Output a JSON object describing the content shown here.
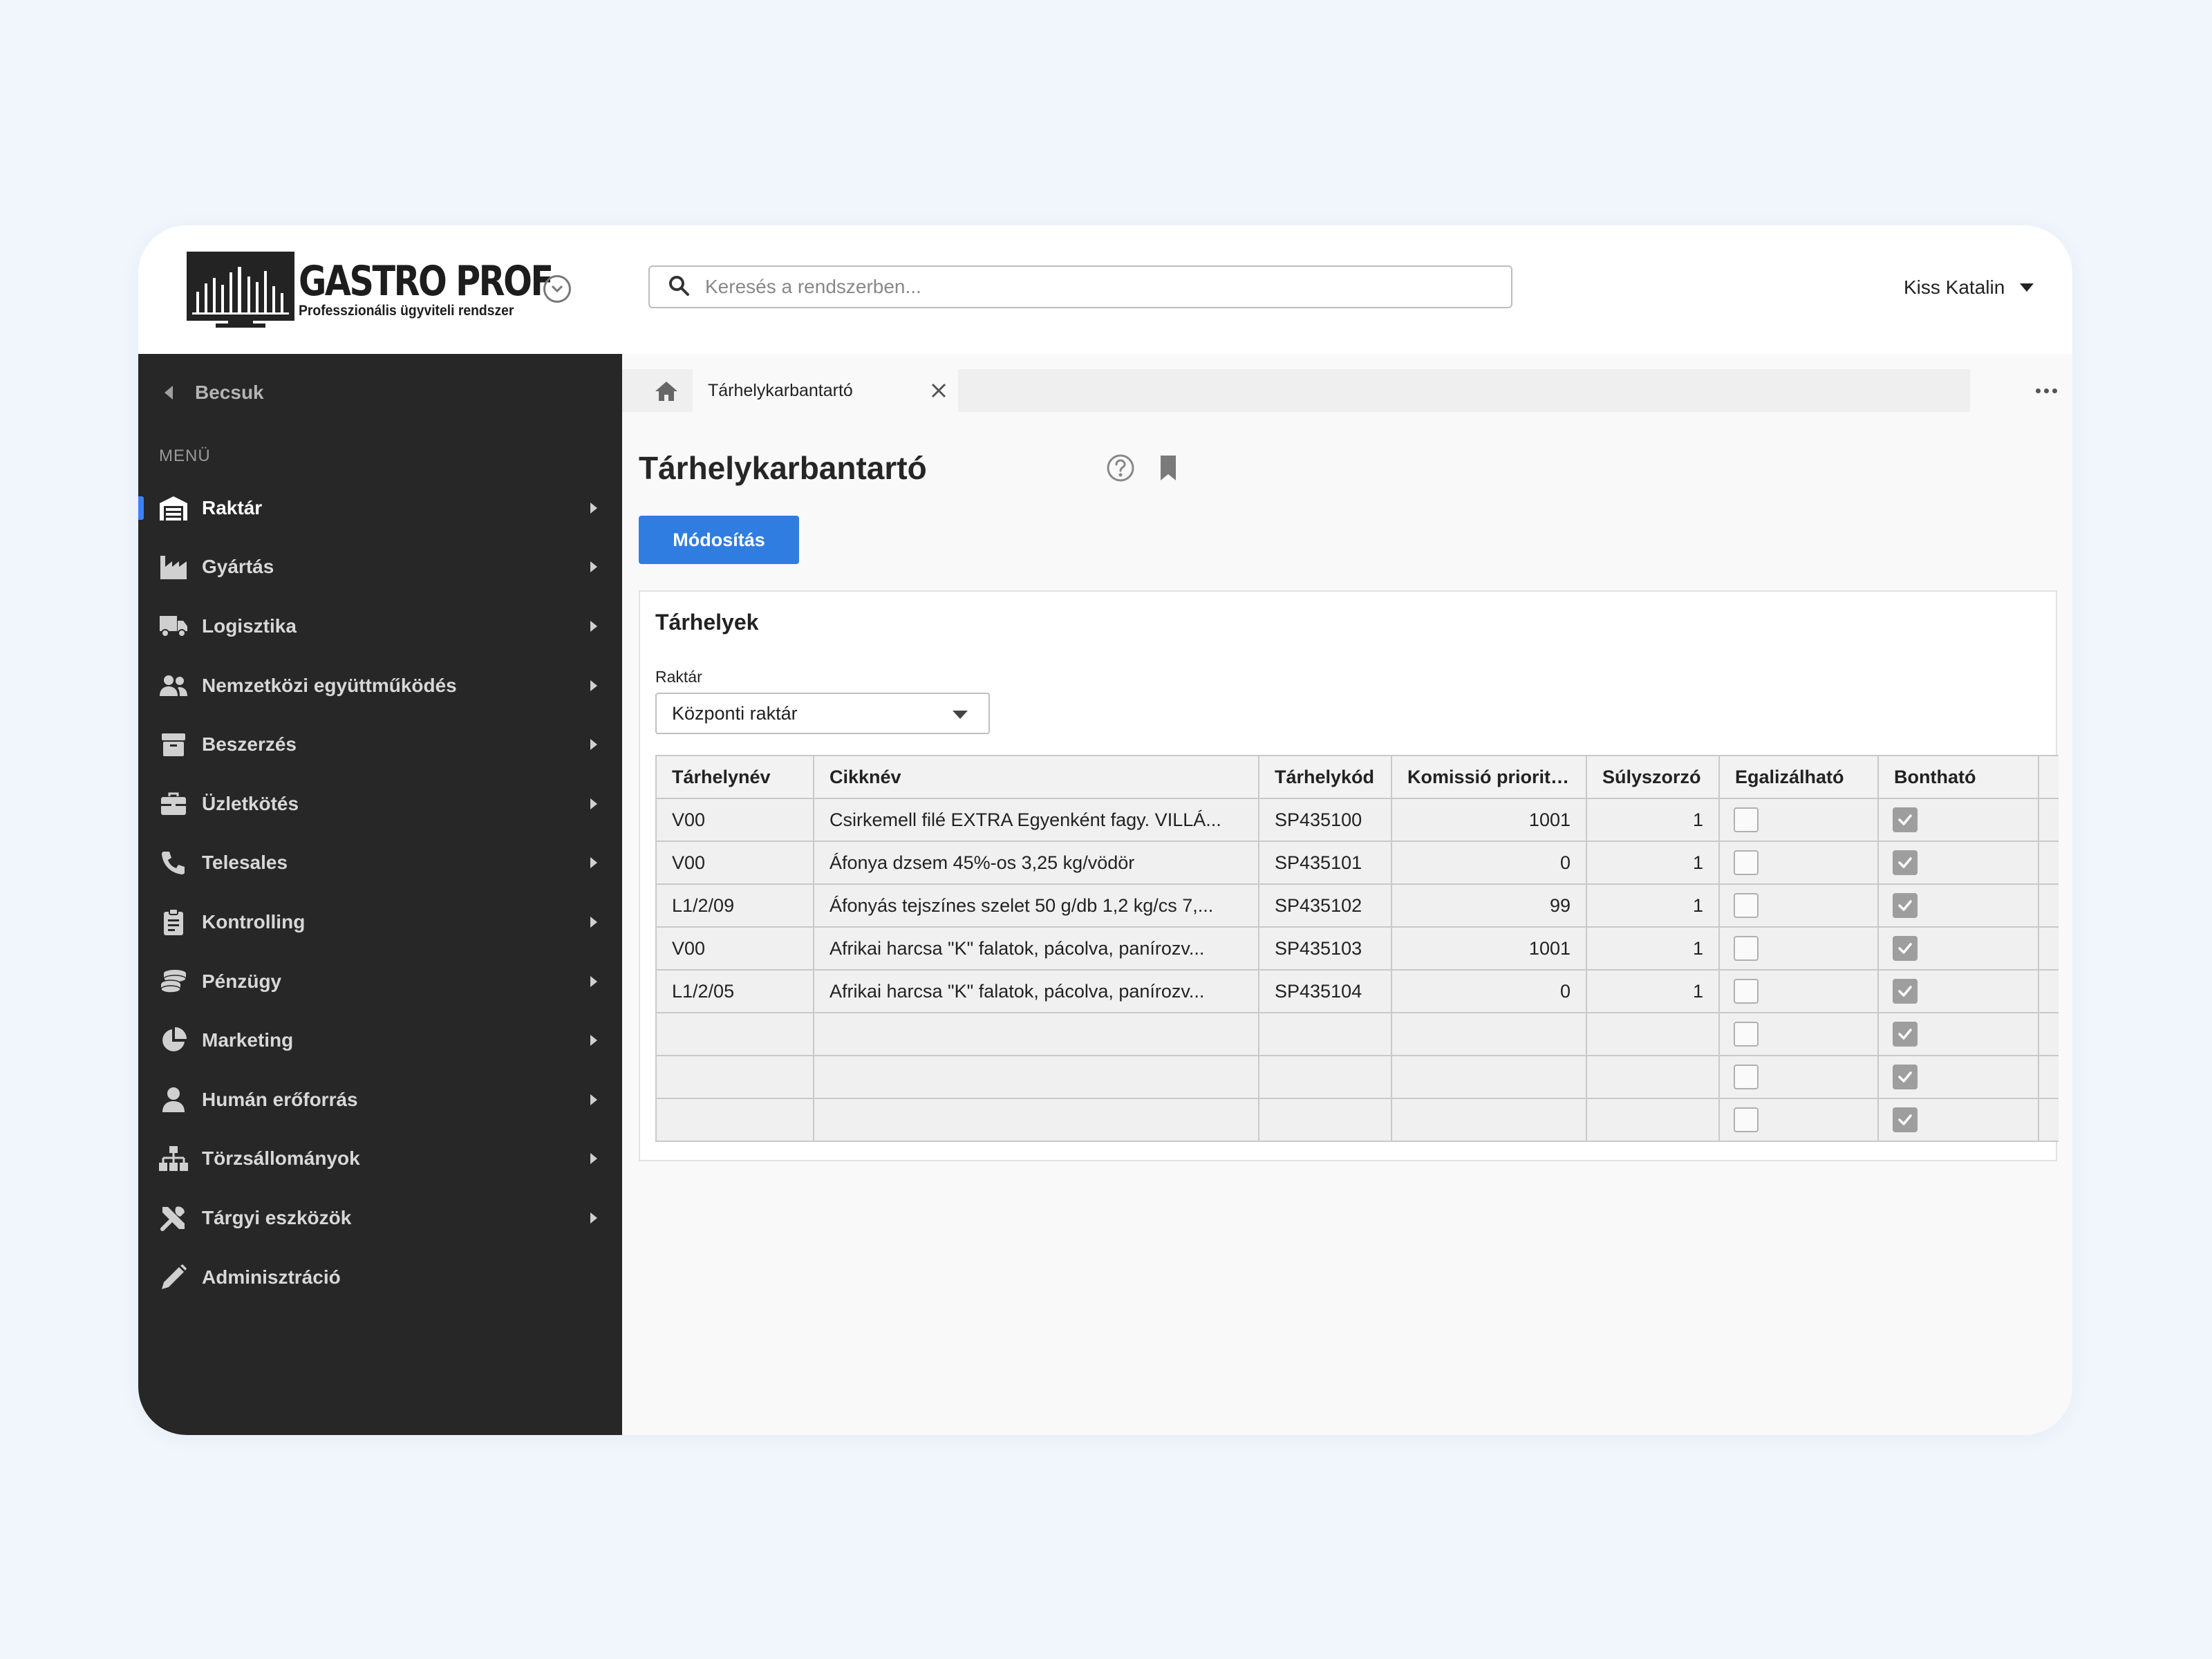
{
  "app": {
    "logo_title": "GASTRO PROF",
    "logo_subtitle": "Professzionális ügyviteli rendszer",
    "search_placeholder": "Keresés a rendszerben...",
    "user_name": "Kiss Katalin"
  },
  "sidebar": {
    "collapse_label": "Becsuk",
    "menu_label": "MENÜ",
    "items": [
      {
        "label": "Raktár",
        "icon": "warehouse-icon",
        "active": true
      },
      {
        "label": "Gyártás",
        "icon": "factory-icon"
      },
      {
        "label": "Logisztika",
        "icon": "truck-icon"
      },
      {
        "label": "Nemzetközi együttműködés",
        "icon": "users-icon"
      },
      {
        "label": "Beszerzés",
        "icon": "box-icon"
      },
      {
        "label": "Üzletkötés",
        "icon": "briefcase-icon"
      },
      {
        "label": "Telesales",
        "icon": "phone-icon"
      },
      {
        "label": "Kontrolling",
        "icon": "clipboard-icon"
      },
      {
        "label": "Pénzügy",
        "icon": "coins-icon"
      },
      {
        "label": "Marketing",
        "icon": "pie-chart-icon"
      },
      {
        "label": "Humán erőforrás",
        "icon": "user-icon"
      },
      {
        "label": "Törzsállományok",
        "icon": "sitemap-icon"
      },
      {
        "label": "Tárgyi eszközök",
        "icon": "tools-icon"
      },
      {
        "label": "Adminisztráció",
        "icon": "pencil-icon"
      }
    ]
  },
  "tabs": {
    "active_tab": "Tárhelykarbantartó"
  },
  "page": {
    "title": "Tárhelykarbantartó",
    "modify_button": "Módosítás"
  },
  "panel": {
    "title": "Tárhelyek",
    "warehouse_label": "Raktár",
    "warehouse_value": "Központi raktár"
  },
  "table": {
    "headers": [
      "Tárhelynév",
      "Cikknév",
      "Tárhelykód",
      "Komissió prioritás",
      "Súlyszorzó",
      "Egalizálható",
      "Bontható"
    ],
    "rows": [
      {
        "name": "V00",
        "item": "Csirkemell filé EXTRA Egyenként fagy. VILLÁ...",
        "code": "SP435100",
        "priority": "1001",
        "weight": "1",
        "egal": false,
        "bont": true
      },
      {
        "name": "V00",
        "item": "Áfonya dzsem 45%-os 3,25 kg/vödör",
        "code": "SP435101",
        "priority": "0",
        "weight": "1",
        "egal": false,
        "bont": true
      },
      {
        "name": "L1/2/09",
        "item": "Áfonyás tejszínes szelet 50 g/db 1,2 kg/cs 7,...",
        "code": "SP435102",
        "priority": "99",
        "weight": "1",
        "egal": false,
        "bont": true
      },
      {
        "name": "V00",
        "item": "Afrikai harcsa  \"K\" falatok, pácolva, panírozv...",
        "code": "SP435103",
        "priority": "1001",
        "weight": "1",
        "egal": false,
        "bont": true
      },
      {
        "name": "L1/2/05",
        "item": "Afrikai harcsa  \"K\" falatok, pácolva, panírozv...",
        "code": "SP435104",
        "priority": "0",
        "weight": "1",
        "egal": false,
        "bont": true
      },
      {
        "name": "",
        "item": "",
        "code": "",
        "priority": "",
        "weight": "",
        "egal": false,
        "bont": true
      },
      {
        "name": "",
        "item": "",
        "code": "",
        "priority": "",
        "weight": "",
        "egal": false,
        "bont": true
      },
      {
        "name": "",
        "item": "",
        "code": "",
        "priority": "",
        "weight": "",
        "egal": false,
        "bont": true
      }
    ]
  },
  "colors": {
    "accent": "#2f7de1",
    "sidebar_bg": "#272727",
    "active_marker": "#3b82f6"
  }
}
